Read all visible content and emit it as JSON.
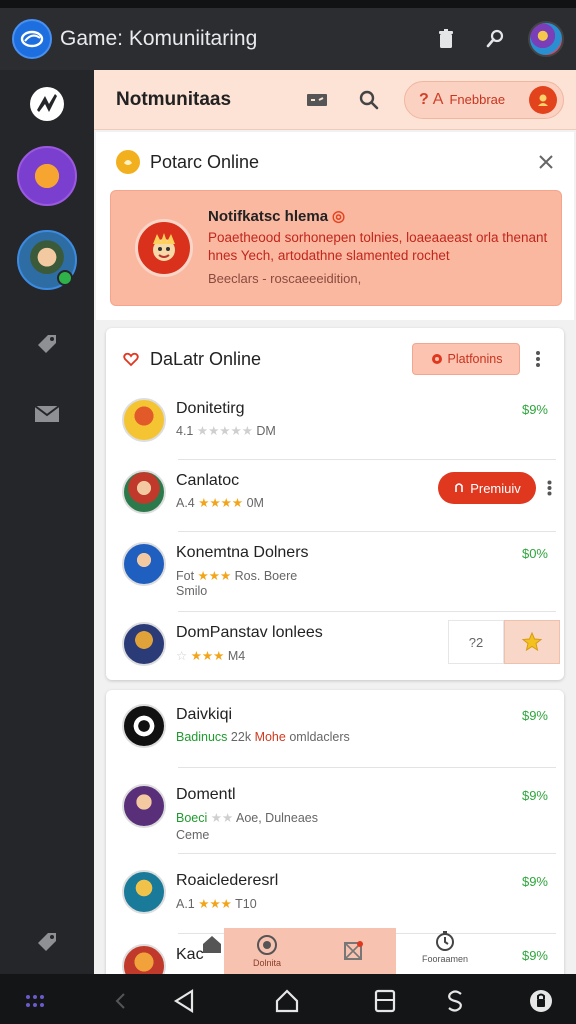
{
  "app": {
    "title": "Game: Komuniitaring"
  },
  "main": {
    "title": "Notmunitaas",
    "pill": {
      "q": "?",
      "a": "A",
      "label": "Fnebbrae"
    }
  },
  "notification": {
    "title": "Potarc Online",
    "heading": "Notifkatsc hlema",
    "ring": "◎",
    "body": "Poaetheood sorhonepen tolnies, loaeaaeast orla thenant hnes Yech, artodathne slamented rochet",
    "meta": "Beeclars - roscaeeeidition,"
  },
  "online_list": {
    "title": "DaLatr Online",
    "filter_label": "Platfonins",
    "rows": [
      {
        "name": "Donitetirg",
        "stars_prefix": "4.1",
        "stars": "★★★★★",
        "sub_suffix": "DM",
        "price": "$9%"
      },
      {
        "name": "Canlatoc",
        "stars_prefix": "A.4",
        "stars": "★★★★",
        "sub_suffix": "0M",
        "action": "Premiuiv"
      },
      {
        "name": "Konemtna Dolners",
        "stars_prefix": "Fot",
        "stars": "★★★",
        "sub_suffix": "Ros. Boere",
        "sub2": "Smilo",
        "price": "$0%"
      },
      {
        "name": "DomPanstav lonlees",
        "stars_prefix": "☆",
        "stars": "★★★",
        "sub_suffix": "M4",
        "qty": "?2"
      }
    ]
  },
  "friends_list": {
    "rows": [
      {
        "name": "Daivkiqi",
        "sub_green": "Badinucs",
        "sub_mid": "22k",
        "sub_red": "Mohe",
        "sub_suffix": "omldaclers",
        "price": "$9%"
      },
      {
        "name": "Domentl",
        "sub_green": "Boeci",
        "stars": "★★",
        "sub_suffix": "Aoe, Dulneaes",
        "sub2": "Ceme",
        "price": "$9%"
      },
      {
        "name": "Roaiclederesrl",
        "stars_prefix": "A.1",
        "stars": "★★★",
        "sub_suffix": "T10",
        "price": "$9%"
      },
      {
        "name": "Kac",
        "price": "$9%"
      }
    ]
  },
  "float_tabs": {
    "active_label": "Dolnita",
    "clock_label": "Fooraamen"
  },
  "colors": {
    "accent": "#e0371f",
    "header_bg": "#fde2d6",
    "notif_bg": "#fbb8a1",
    "price_green": "#2ea53b",
    "rail_bg": "#242629",
    "appbar_bg": "#2b2d31"
  },
  "icons": [
    "app-logo-icon",
    "trash-icon",
    "person-search-icon",
    "user-avatar",
    "brand-icon",
    "game-icon",
    "tag-icon",
    "mail-icon",
    "settings-icon",
    "mail-badge-icon",
    "search-icon",
    "coin-icon",
    "close-icon",
    "mascot-icon",
    "heart-icon",
    "more-icon",
    "star-icon",
    "home-icon",
    "wallet-icon",
    "clock-icon"
  ]
}
